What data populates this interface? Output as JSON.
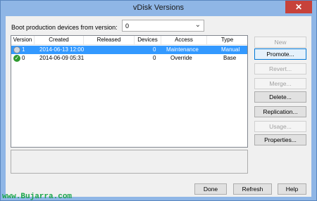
{
  "window": {
    "title": "vDisk Versions",
    "close_label": "✕"
  },
  "boot": {
    "label": "Boot production devices from version:",
    "selected": "0"
  },
  "table": {
    "columns": [
      "Version",
      "Created",
      "Released",
      "Devices",
      "Access",
      "Type"
    ],
    "rows": [
      {
        "version": "1",
        "created": "2014-06-13 12:00",
        "released": "",
        "devices": "0",
        "access": "Maintenance",
        "type": "Manual",
        "icon": "gear-disk-icon",
        "selected": true
      },
      {
        "version": "0",
        "created": "2014-06-09 05:31",
        "released": "",
        "devices": "0",
        "access": "Override",
        "type": "Base",
        "icon": "check-disk-icon",
        "selected": false
      }
    ]
  },
  "actions": {
    "new": "New",
    "promote": "Promote...",
    "revert": "Revert...",
    "merge": "Merge...",
    "delete": "Delete...",
    "replication": "Replication...",
    "usage": "Usage...",
    "properties": "Properties..."
  },
  "footer": {
    "done": "Done",
    "refresh": "Refresh",
    "help": "Help"
  },
  "watermark": "www.Bujarra.com",
  "colors": {
    "selection": "#3399ff",
    "titlebar": "#8fb6e6",
    "close": "#c7423a",
    "watermark": "#1aa64a"
  }
}
